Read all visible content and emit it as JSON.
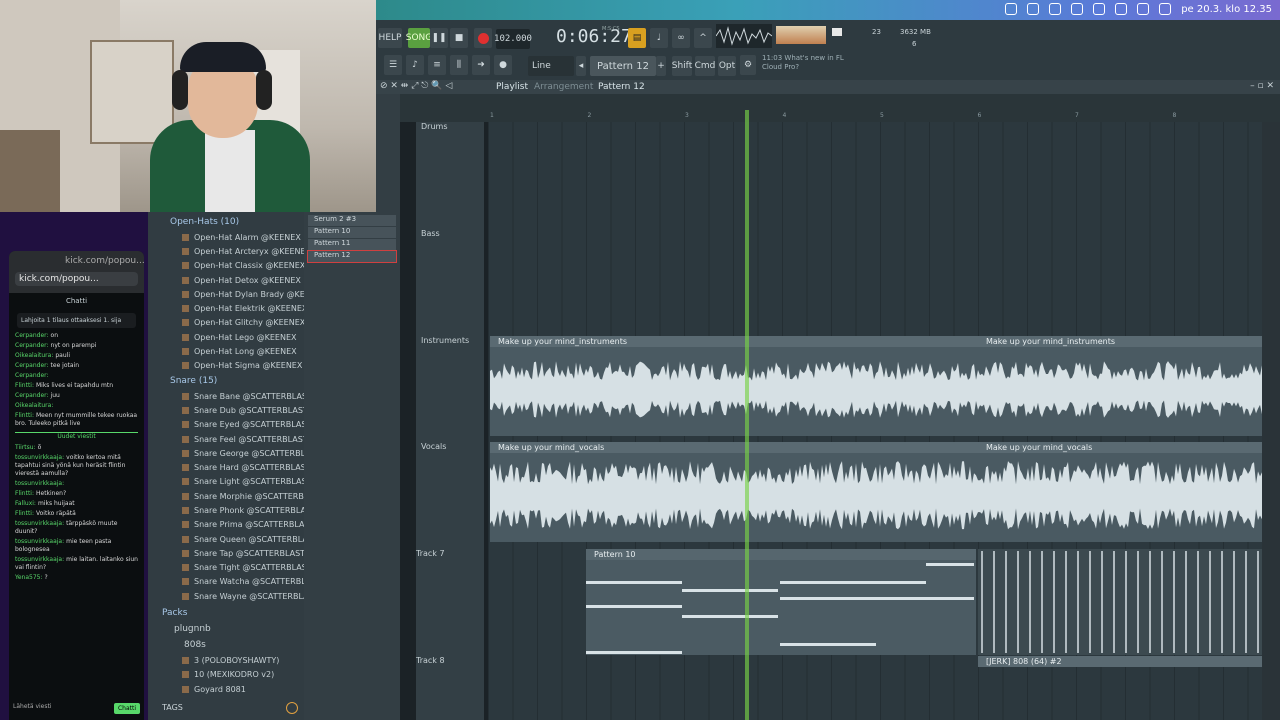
{
  "menubar": {
    "datetime": "pe 20.3. klo 12.35"
  },
  "toolbar": {
    "help": "HELP",
    "song_label": "SONG",
    "tempo": "102.000",
    "time": "0:06:27",
    "time_sub": "M:S:CS",
    "cpu": "23",
    "mem": "3632 MB",
    "voices": "6",
    "snap_mode": "Line",
    "pattern": "Pattern 12",
    "shift": "Shift",
    "cmd": "Cmd",
    "opt": "Opt",
    "news": "11:03 What's new in FL Cloud Pro?"
  },
  "playlist": {
    "title": "Playlist",
    "subtitle": "Arrangement",
    "pattern": "Pattern 12",
    "bars": [
      "1",
      "2",
      "3",
      "4",
      "5",
      "6",
      "7",
      "8"
    ]
  },
  "tracks": [
    {
      "name": "Drums"
    },
    {
      "name": "Bass"
    },
    {
      "name": "Instruments"
    },
    {
      "name": "Vocals"
    },
    {
      "name": "Track 7"
    },
    {
      "name": "Track 8"
    }
  ],
  "clips": {
    "instr": "Make up your mind_instruments",
    "vocals": "Make up your mind_vocals",
    "pattern10": "Pattern 10",
    "jerk": "[JERK] 808 (64) #2"
  },
  "patterns": [
    "Serum 2 #3",
    "Pattern 10",
    "Pattern 11",
    "Pattern 12"
  ],
  "browser": {
    "folder_openhats": "Open-Hats (10)",
    "openhats": [
      "Open-Hat Alarm @KEENEX",
      "Open-Hat Arcteryx @KEENEX",
      "Open-Hat Classix @KEENEX",
      "Open-Hat Detox @KEENEX",
      "Open-Hat Dylan Brady @KEENEX",
      "Open-Hat Elektrik @KEENEX",
      "Open-Hat Glitchy @KEENEX",
      "Open-Hat Lego @KEENEX",
      "Open-Hat Long @KEENEX",
      "Open-Hat Sigma @KEENEX"
    ],
    "folder_snare": "Snare (15)",
    "snares": [
      "Snare Bane @SCATTERBLAST",
      "Snare Dub @SCATTERBLAST",
      "Snare Eyed @SCATTERBLAST",
      "Snare Feel @SCATTERBLAST",
      "Snare George @SCATTERBLAST",
      "Snare Hard @SCATTERBLAST",
      "Snare Light @SCATTERBLAST",
      "Snare Morphie @SCATTERBLAST",
      "Snare Phonk @SCATTERBLAST",
      "Snare Prima @SCATTERBLAST",
      "Snare Queen @SCATTERBLAST",
      "Snare Tap @SCATTERBLAST",
      "Snare Tight @SCATTERBLAST",
      "Snare Watcha @SCATTERBLAST",
      "Snare Wayne @SCATTERBLAST"
    ],
    "packs": "Packs",
    "plugnnb": "plugnnb",
    "f808s": "808s",
    "items808": [
      "3 (POLOBOYSHAWTY)",
      "10 (MEXIKODRO v2)",
      "Goyard 8081"
    ],
    "tags": "TAGS"
  },
  "chat": {
    "url_title": "kick.com/popou...",
    "url": "kick.com/popou...",
    "header": "Chatti",
    "notice": "Lahjoita 1 tilaus ottaaksesi 1. sija",
    "messages": [
      {
        "user": "Cerpander:",
        "text": "on"
      },
      {
        "user": "Cerpander:",
        "text": "nyt on parempi"
      },
      {
        "user": "Oikealaitura:",
        "text": "pauli"
      },
      {
        "user": "Cerpander:",
        "text": "tee jotain"
      },
      {
        "user": "Cerpander:",
        "text": ""
      },
      {
        "user": "Flintti:",
        "text": "Miks lives ei tapahdu mtn"
      },
      {
        "user": "Cerpander:",
        "text": "juu"
      },
      {
        "user": "Oikealaitura:",
        "text": ""
      },
      {
        "user": "Flintti:",
        "text": "Meen nyt mummille tekee ruokaa bro. Tuleeko pitkä live"
      }
    ],
    "divider": "Uudet viestit",
    "messages2": [
      {
        "user": "Tiirtsu:",
        "text": "õ"
      },
      {
        "user": "tossunvirkkaaja:",
        "text": "voitko kertoa mitä tapahtui sinä yönä kun heräsit flintin vierestä aamulla?"
      },
      {
        "user": "tossunvirkkaaja:",
        "text": ""
      },
      {
        "user": "Flintti:",
        "text": "Hetkinen?"
      },
      {
        "user": "Falluxi:",
        "text": "miks huijaat"
      },
      {
        "user": "Flintti:",
        "text": "Voitko räpätä"
      },
      {
        "user": "tossunvirkkaaja:",
        "text": "tärppäskö muute duunit?"
      },
      {
        "user": "tossunvirkkaaja:",
        "text": "mie teen pasta bolognesea"
      },
      {
        "user": "tossunvirkkaaja:",
        "text": "mie laitan. laitanko siun vai flintin?"
      },
      {
        "user": "Yena575:",
        "text": "?"
      }
    ],
    "send": "Lähetä viesti",
    "chat_btn": "Chatti"
  }
}
